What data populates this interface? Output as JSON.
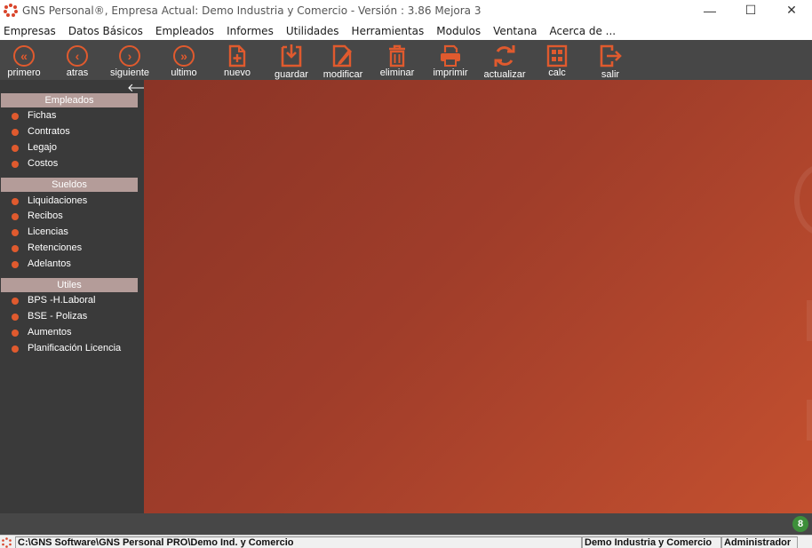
{
  "window": {
    "title": "GNS Personal®, Empresa Actual: Demo Industria y Comercio - Versión : 3.86 Mejora 3",
    "minimize_glyph": "—",
    "maximize_glyph": "☐",
    "close_glyph": "✕"
  },
  "menu": [
    "Empresas",
    "Datos Básicos",
    "Empleados",
    "Informes",
    "Utilidades",
    "Herramientas",
    "Modulos",
    "Ventana",
    "Acerca de ..."
  ],
  "toolbar": {
    "accent": "#e05a2e",
    "buttons": [
      {
        "label": "primero",
        "icon": "double-left-arrow-icon"
      },
      {
        "label": "atras",
        "icon": "left-arrow-icon"
      },
      {
        "label": "siguiente",
        "icon": "right-arrow-icon"
      },
      {
        "label": "ultimo",
        "icon": "double-right-arrow-icon"
      },
      {
        "label": "nuevo",
        "icon": "new-document-icon"
      },
      {
        "label": "guardar",
        "icon": "save-icon"
      },
      {
        "label": "modificar",
        "icon": "edit-icon"
      },
      {
        "label": "eliminar",
        "icon": "trash-icon"
      },
      {
        "label": "imprimir",
        "icon": "printer-icon"
      },
      {
        "label": "actualizar",
        "icon": "refresh-icon"
      },
      {
        "label": "calc",
        "icon": "calculator-icon"
      },
      {
        "label": "salir",
        "icon": "exit-icon"
      }
    ]
  },
  "sidebar": {
    "collapse_glyph": "🡐",
    "sections": [
      {
        "title": "Empleados",
        "items": [
          "Fichas",
          "Contratos",
          "Legajo",
          "Costos"
        ]
      },
      {
        "title": "Sueldos",
        "items": [
          "Liquidaciones",
          "Recibos",
          "Licencias",
          "Retenciones",
          "Adelantos"
        ]
      },
      {
        "title": "Utiles",
        "items": [
          "BPS -H.Laboral",
          "BSE - Polizas",
          "Aumentos",
          "Planificación Licencia"
        ]
      }
    ]
  },
  "notification_badge": "8",
  "statusbar": {
    "path": "C:\\GNS Software\\GNS Personal PRO\\Demo Ind. y Comercio",
    "company": "Demo Industria y Comercio",
    "user": "Administrador"
  }
}
